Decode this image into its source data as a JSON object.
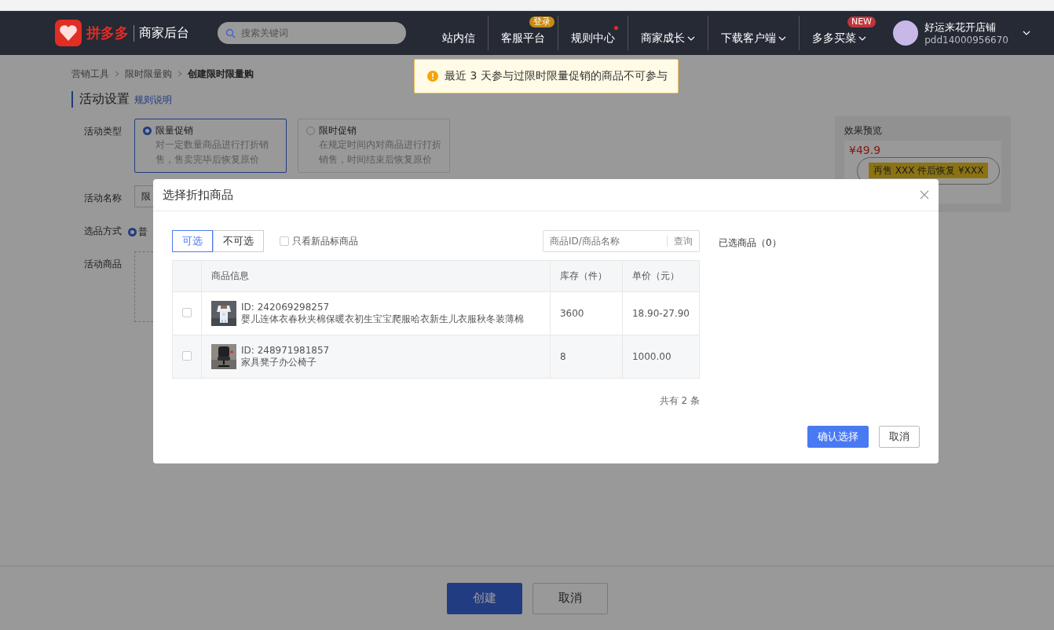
{
  "header": {
    "logo": "拼多多",
    "subtitle": "商家后台",
    "search": {
      "placeholder": "搜索关键词"
    },
    "nav": [
      {
        "label": "站内信",
        "dropdown": false,
        "dot": false
      },
      {
        "label": "客服平台",
        "dropdown": false,
        "dot": false,
        "badge": {
          "text": "登录",
          "color": "#c98a12"
        }
      },
      {
        "label": "规则中心",
        "dropdown": false,
        "dot": true
      },
      {
        "label": "商家成长",
        "dropdown": true,
        "dot": false
      },
      {
        "label": "下载客户端",
        "dropdown": true,
        "dot": false
      },
      {
        "label": "多多买菜",
        "dropdown": true,
        "dot": false,
        "badge": {
          "text": "NEW",
          "color": "#c0353a"
        }
      }
    ],
    "shop": {
      "name": "好运来花开店铺",
      "id": "pdd14000956670"
    }
  },
  "breadcrumb": [
    {
      "label": "营销工具",
      "current": false
    },
    {
      "label": "限时限量购",
      "current": false
    },
    {
      "label": "创建限时限量购",
      "current": true
    }
  ],
  "section": {
    "title": "活动设置",
    "link": "规则说明"
  },
  "form": {
    "activity_type": {
      "label": "活动类型",
      "options": [
        {
          "title": "限量促销",
          "description": "对一定数量商品进行打折销售，售卖完毕后恢复原价",
          "selected": true
        },
        {
          "title": "限时促销",
          "description": "在规定时间内对商品进行打折销售，时间结束后恢复原价",
          "selected": false
        }
      ]
    },
    "name": {
      "label": "活动名称",
      "value": "限"
    },
    "method": {
      "label": "选品方式",
      "option": "普",
      "selected": true
    },
    "goods": {
      "label": "活动商品"
    }
  },
  "preview": {
    "title": "效果预览",
    "price": "¥49.9",
    "bubble": "再售 XXX 件后恢复 ¥XXX"
  },
  "toast": "最近 3 天参与过限时限量促销的商品不可参与",
  "modal": {
    "title": "选择折扣商品",
    "tabs": [
      {
        "label": "可选",
        "selected": true
      },
      {
        "label": "不可选",
        "selected": false
      }
    ],
    "filter": {
      "label": "只看新品标商品",
      "checked": false
    },
    "search": {
      "placeholder": "商品ID/商品名称",
      "button": "查询"
    },
    "columns": [
      "商品信息",
      "库存（件）",
      "单价（元）"
    ],
    "rows": [
      {
        "id": "ID: 242069298257",
        "name": "婴儿连体衣春秋夹棉保暖衣初生宝宝爬服哈衣新生儿衣服秋冬装薄棉",
        "stock": "3600",
        "price": "18.90-27.90",
        "checked": false
      },
      {
        "id": "ID: 248971981857",
        "name": "家具凳子办公椅子",
        "stock": "8",
        "price": "1000.00",
        "checked": false
      }
    ],
    "total": "共有 2 条",
    "selected_title": "已选商品（0）",
    "buttons": [
      {
        "label": "确认选择",
        "kind": "primary"
      },
      {
        "label": "取消",
        "kind": "default"
      }
    ]
  },
  "footer": {
    "buttons": [
      {
        "label": "创建",
        "kind": "primary"
      },
      {
        "label": "取消",
        "kind": "default"
      }
    ]
  }
}
